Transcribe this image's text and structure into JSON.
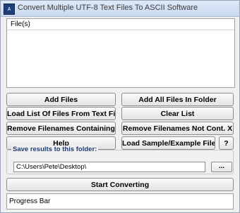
{
  "window": {
    "title": "Convert Multiple UTF-8 Text Files To ASCII Software",
    "icon": "app-icon"
  },
  "file_list": {
    "header": "File(s)",
    "items": []
  },
  "buttons": {
    "add_files": "Add Files",
    "add_all_files_in_folder": "Add All Files In Folder",
    "load_list": "Load List Of Files From Text File",
    "clear_list": "Clear List",
    "remove_containing": "Remove Filenames Containing X",
    "remove_not_containing": "Remove Filenames Not Cont. X",
    "help": "Help",
    "load_sample": "Load Sample/Example Files",
    "question": "?",
    "start_converting": "Start Converting"
  },
  "save_group": {
    "label": "Save results to this folder:",
    "path": "C:\\Users\\Pete\\Desktop\\",
    "browse_label": "..."
  },
  "progress": {
    "label": "Progress Bar"
  }
}
